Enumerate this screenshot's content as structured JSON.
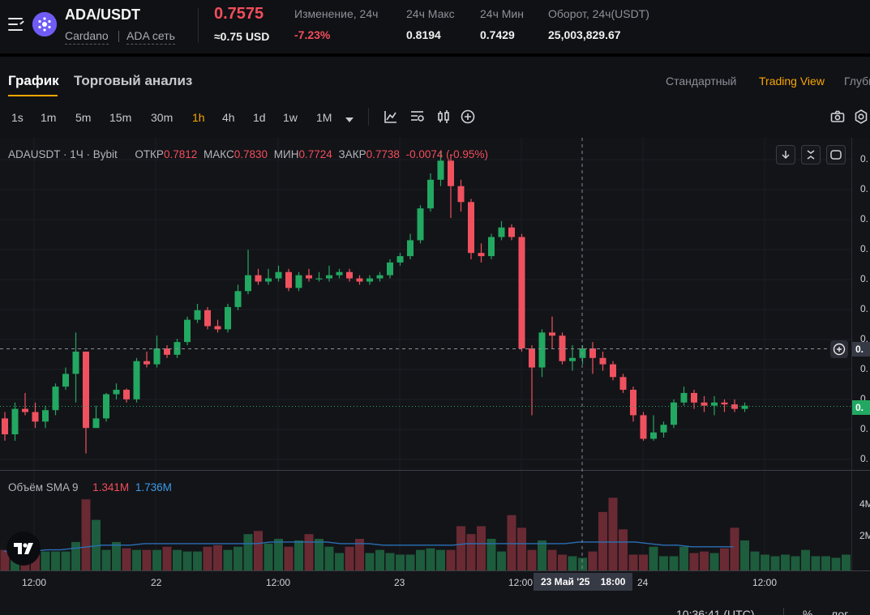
{
  "header": {
    "pair": "ADA/USDT",
    "coin_name": "Cardano",
    "network": "ADA сеть",
    "last_price": "0.7575",
    "usd_price": "≈0.75 USD",
    "stats": [
      {
        "label": "Изменение, 24ч",
        "value": "-7.23%",
        "negative": true
      },
      {
        "label": "24ч Макс",
        "value": "0.8194",
        "negative": false
      },
      {
        "label": "24ч Мин",
        "value": "0.7429",
        "negative": false
      },
      {
        "label": "Оборот, 24ч(USDT)",
        "value": "25,003,829.67",
        "negative": false
      }
    ]
  },
  "tabs": [
    {
      "label": "График",
      "active": true
    },
    {
      "label": "Торговый анализ",
      "active": false
    }
  ],
  "view_options": [
    {
      "label": "Стандартный",
      "active": false
    },
    {
      "label": "Trading View",
      "active": true
    },
    {
      "label": "Глубина",
      "active": false
    }
  ],
  "timeframes": [
    {
      "label": "1s",
      "active": false
    },
    {
      "label": "1m",
      "active": false
    },
    {
      "label": "5m",
      "active": false
    },
    {
      "label": "15m",
      "active": false
    },
    {
      "label": "30m",
      "active": false
    },
    {
      "label": "1h",
      "active": true
    },
    {
      "label": "4h",
      "active": false
    },
    {
      "label": "1d",
      "active": false
    },
    {
      "label": "1w",
      "active": false
    },
    {
      "label": "1M",
      "active": false
    }
  ],
  "toolbar_icons": [
    "indicators-icon",
    "chart-settings-icon",
    "candle-type-icon",
    "add-icon"
  ],
  "legend": {
    "symbol": "ADAUSDT · 1Ч · Bybit",
    "open_label": "ОТКР",
    "open": "0.7812",
    "high_label": "МАКС",
    "high": "0.7830",
    "low_label": "МИН",
    "low": "0.7724",
    "close_label": "ЗАКР",
    "close": "0.7738",
    "change": "-0.0074 (-0.95%)"
  },
  "volume_legend": {
    "label": "Объём SMA 9",
    "value1": "1.341M",
    "value2": "1.736M"
  },
  "price_axis": {
    "ticks": [
      "0.",
      "0.",
      "0.",
      "0.",
      "0.",
      "0.",
      "0.",
      "0.",
      "0.",
      "0.",
      "0."
    ],
    "crosshair_label": "0.",
    "last_price_label": "0."
  },
  "volume_axis": {
    "ticks": [
      "4M",
      "2M"
    ]
  },
  "time_axis": {
    "ticks": [
      "12:00",
      "22",
      "12:00",
      "23",
      "12:00",
      "24",
      "12:00"
    ],
    "crosshair_label": "23 Май '25    18:00"
  },
  "footer": {
    "clock": "10:36:41 (UTC)",
    "percent": "%",
    "log": "лог"
  },
  "colors": {
    "up": "#22a861",
    "down": "#f0515f",
    "accent": "#f7a600",
    "sma": "#2a6fb5"
  },
  "chart_data": {
    "type": "candlestick",
    "series": [
      {
        "name": "ADAUSDT",
        "candles": [
          [
            0.7775,
            0.775,
            0.7785,
            0.774
          ],
          [
            0.775,
            0.779,
            0.78,
            0.774
          ],
          [
            0.779,
            0.7785,
            0.7815,
            0.778
          ],
          [
            0.7785,
            0.777,
            0.78,
            0.776
          ],
          [
            0.777,
            0.7788,
            0.7795,
            0.776
          ],
          [
            0.7788,
            0.7825,
            0.783,
            0.778
          ],
          [
            0.7825,
            0.7845,
            0.7855,
            0.782
          ],
          [
            0.7845,
            0.788,
            0.791,
            0.78
          ],
          [
            0.788,
            0.776,
            0.788,
            0.772
          ],
          [
            0.776,
            0.7775,
            0.7795,
            0.776
          ],
          [
            0.7775,
            0.7813,
            0.7815,
            0.777
          ],
          [
            0.7813,
            0.782,
            0.783,
            0.7805
          ],
          [
            0.782,
            0.7805,
            0.7822,
            0.78
          ],
          [
            0.7805,
            0.7865,
            0.787,
            0.78
          ],
          [
            0.7865,
            0.786,
            0.788,
            0.7855
          ],
          [
            0.786,
            0.7885,
            0.7905,
            0.7855
          ],
          [
            0.7885,
            0.7875,
            0.789,
            0.787
          ],
          [
            0.7875,
            0.7895,
            0.79,
            0.787
          ],
          [
            0.7895,
            0.793,
            0.7935,
            0.789
          ],
          [
            0.793,
            0.7945,
            0.7955,
            0.7925
          ],
          [
            0.7945,
            0.792,
            0.795,
            0.7915
          ],
          [
            0.792,
            0.7915,
            0.793,
            0.791
          ],
          [
            0.7915,
            0.795,
            0.7955,
            0.791
          ],
          [
            0.795,
            0.7975,
            0.7985,
            0.7945
          ],
          [
            0.7975,
            0.8,
            0.804,
            0.797
          ],
          [
            0.8,
            0.799,
            0.801,
            0.7985
          ],
          [
            0.799,
            0.7995,
            0.801,
            0.7985
          ],
          [
            0.7995,
            0.8005,
            0.8015,
            0.799
          ],
          [
            0.8005,
            0.798,
            0.801,
            0.7975
          ],
          [
            0.798,
            0.8,
            0.8005,
            0.7975
          ],
          [
            0.8,
            0.7995,
            0.801,
            0.799
          ],
          [
            0.7995,
            0.7995,
            0.8005,
            0.799
          ],
          [
            0.7995,
            0.8,
            0.8015,
            0.799
          ],
          [
            0.8,
            0.8005,
            0.801,
            0.7995
          ],
          [
            0.8005,
            0.7995,
            0.801,
            0.799
          ],
          [
            0.7995,
            0.799,
            0.8,
            0.7985
          ],
          [
            0.799,
            0.7995,
            0.8,
            0.7985
          ],
          [
            0.7995,
            0.8,
            0.8005,
            0.799
          ],
          [
            0.8,
            0.802,
            0.8025,
            0.7995
          ],
          [
            0.802,
            0.803,
            0.8035,
            0.8015
          ],
          [
            0.803,
            0.8055,
            0.8065,
            0.8025
          ],
          [
            0.8055,
            0.8105,
            0.811,
            0.805
          ],
          [
            0.8105,
            0.815,
            0.816,
            0.81
          ],
          [
            0.815,
            0.818,
            0.8194,
            0.814
          ],
          [
            0.818,
            0.814,
            0.819,
            0.809
          ],
          [
            0.814,
            0.8115,
            0.815,
            0.81
          ],
          [
            0.8115,
            0.8035,
            0.812,
            0.8025
          ],
          [
            0.8035,
            0.803,
            0.805,
            0.802
          ],
          [
            0.803,
            0.806,
            0.8065,
            0.8025
          ],
          [
            0.806,
            0.8075,
            0.8085,
            0.8055
          ],
          [
            0.8075,
            0.806,
            0.808,
            0.8055
          ],
          [
            0.806,
            0.7885,
            0.8065,
            0.788
          ],
          [
            0.7885,
            0.7855,
            0.789,
            0.778
          ],
          [
            0.7855,
            0.791,
            0.7915,
            0.784
          ],
          [
            0.791,
            0.7905,
            0.7935,
            0.7885
          ],
          [
            0.7905,
            0.7865,
            0.791,
            0.786
          ],
          [
            0.7865,
            0.787,
            0.789,
            0.785
          ],
          [
            0.787,
            0.7885,
            0.789,
            0.786
          ],
          [
            0.7885,
            0.787,
            0.7895,
            0.7845
          ],
          [
            0.787,
            0.786,
            0.788,
            0.785
          ],
          [
            0.786,
            0.784,
            0.7865,
            0.7835
          ],
          [
            0.784,
            0.782,
            0.7845,
            0.7815
          ],
          [
            0.782,
            0.778,
            0.7825,
            0.777
          ],
          [
            0.778,
            0.7743,
            0.7785,
            0.774
          ],
          [
            0.7743,
            0.7753,
            0.778,
            0.774
          ],
          [
            0.7753,
            0.7765,
            0.777,
            0.7745
          ],
          [
            0.7765,
            0.78,
            0.7805,
            0.776
          ],
          [
            0.78,
            0.7815,
            0.7825,
            0.7795
          ],
          [
            0.7815,
            0.78,
            0.782,
            0.779
          ],
          [
            0.78,
            0.7795,
            0.781,
            0.7785
          ],
          [
            0.7795,
            0.78,
            0.781,
            0.778
          ],
          [
            0.78,
            0.7797,
            0.7805,
            0.7785
          ],
          [
            0.7797,
            0.779,
            0.7805,
            0.7785
          ],
          [
            0.779,
            0.7795,
            0.78,
            0.7785
          ]
        ]
      }
    ],
    "volume": [
      1.3,
      1.0,
      1.2,
      1.5,
      1.2,
      1.2,
      1.2,
      1.8,
      4.5,
      3.2,
      1.3,
      1.8,
      1.4,
      1.3,
      1.3,
      1.3,
      1.5,
      1.3,
      1.2,
      1.2,
      1.5,
      1.6,
      1.3,
      1.5,
      2.3,
      2.5,
      1.7,
      2.0,
      1.5,
      1.9,
      2.3,
      2.0,
      1.5,
      1.1,
      1.5,
      2.0,
      1.1,
      1.3,
      1.1,
      1.0,
      1.0,
      1.3,
      1.4,
      1.3,
      1.3,
      2.8,
      2.3,
      2.8,
      2.0,
      1.2,
      3.5,
      2.7,
      1.3,
      1.9,
      1.3,
      1.0,
      0.9,
      0.8,
      1.2,
      3.7,
      4.6,
      2.6,
      1.0,
      1.0,
      1.5,
      0.9,
      0.9,
      1.5,
      1.1,
      1.2,
      1.1,
      1.4,
      2.7,
      1.9,
      1.2,
      1.0,
      0.9,
      1.0,
      0.9,
      1.3,
      0.9,
      0.9,
      0.8,
      1.0,
      0.3
    ],
    "sma": [
      1.2,
      1.2,
      1.2,
      1.3,
      1.3,
      1.4,
      1.5,
      1.6,
      1.6,
      1.6,
      1.7,
      1.7,
      1.7,
      1.7,
      1.7,
      1.7,
      1.7,
      1.7,
      1.7,
      1.8,
      1.8,
      1.8,
      1.8,
      1.8,
      1.7,
      1.7,
      1.7,
      1.6,
      1.6,
      1.6,
      1.6,
      1.6,
      1.6,
      1.7,
      1.7,
      1.7,
      1.7,
      1.7,
      1.7,
      1.7,
      1.7,
      1.8,
      1.8,
      1.8,
      1.8,
      1.8,
      1.7,
      1.6,
      1.6,
      1.5,
      1.5,
      1.5,
      1.5
    ]
  }
}
